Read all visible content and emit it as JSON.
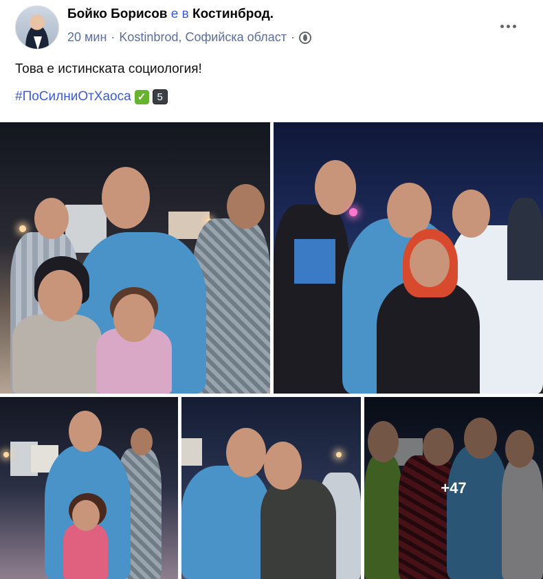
{
  "post": {
    "author": "Бойко Борисов",
    "is_in": "е в",
    "place": "Костинброд.",
    "time": "20 мин",
    "separator": "·",
    "location": "Kostinbrod, Софийска област",
    "privacy_icon": "globe-icon",
    "more_icon": "more-options-icon",
    "text": "Това е истинската социология!",
    "hashtag": "#ПоСилниОтХаоса",
    "emoji_check": "✓",
    "emoji_number": "5"
  },
  "gallery": {
    "photo_count": 5,
    "more_count": "+47"
  },
  "colors": {
    "link": "#3b5bdb",
    "meta": "#5b6da1",
    "text": "#050505"
  }
}
